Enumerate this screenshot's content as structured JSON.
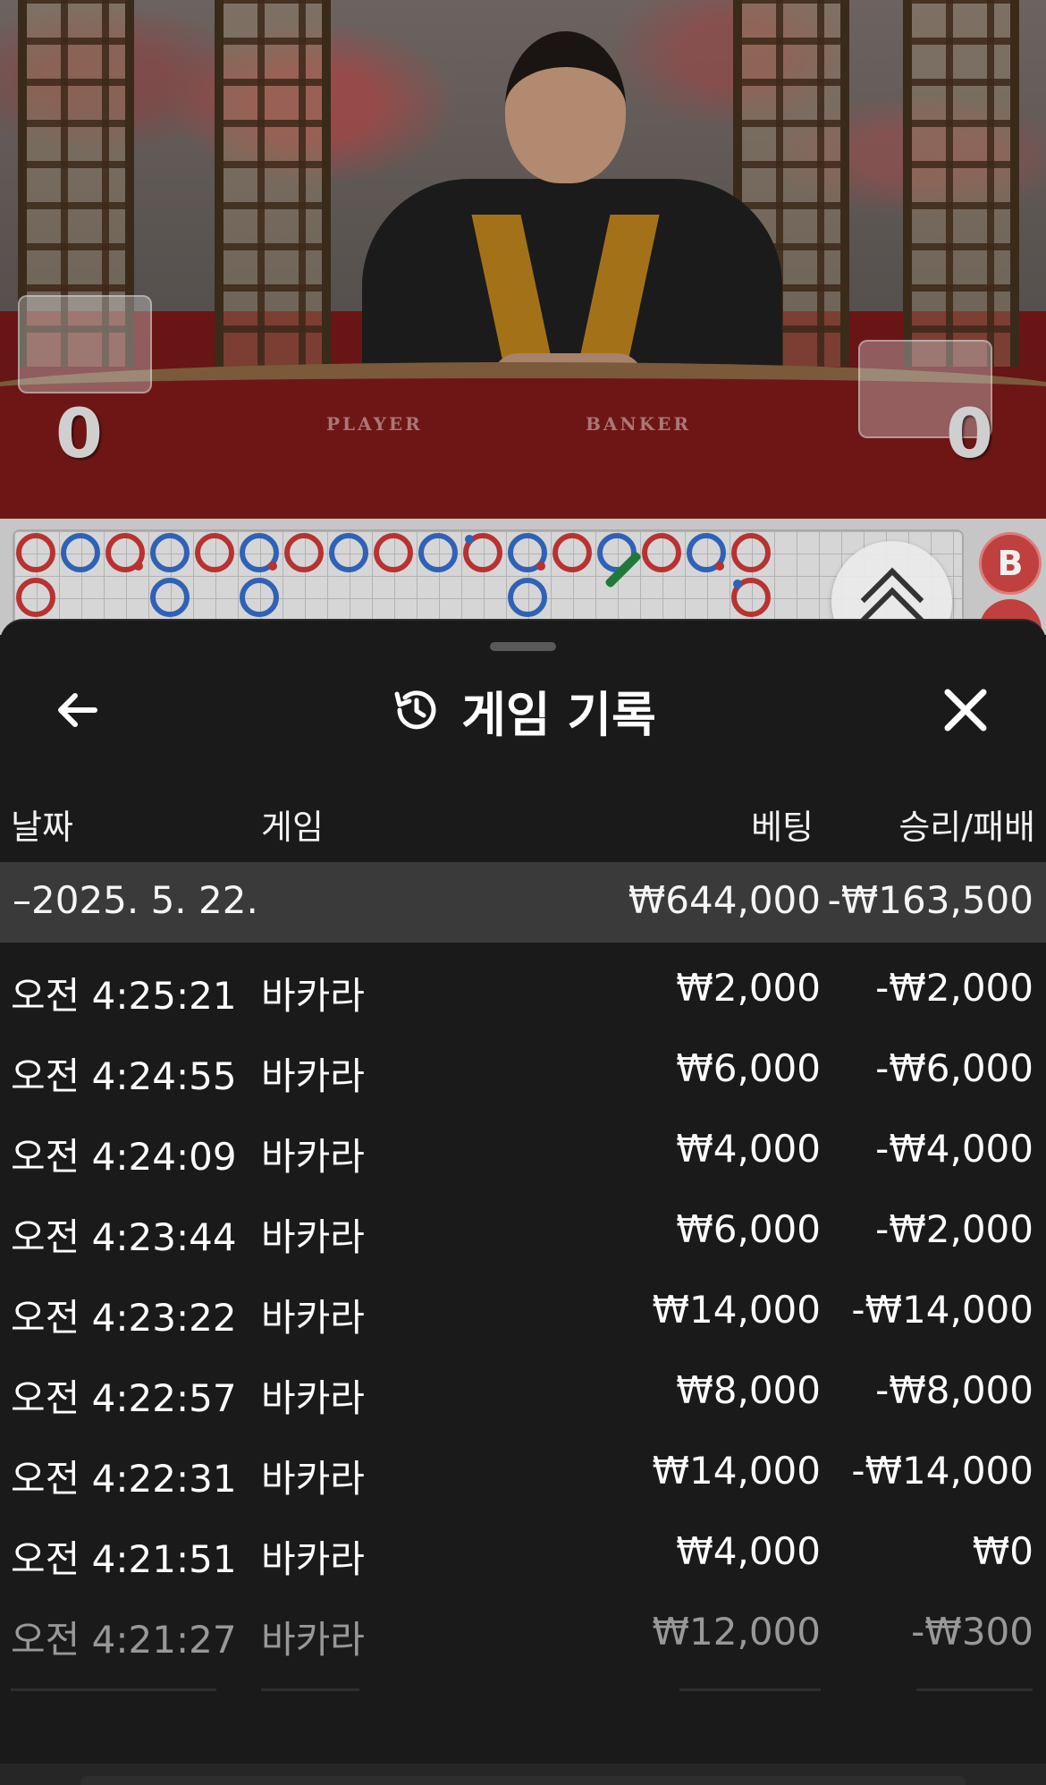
{
  "video": {
    "player_score": "0",
    "banker_score": "0",
    "felt_player_label": "PLAYER",
    "felt_banker_label": "BANKER"
  },
  "roadmap": {
    "bet_chip_label": "B",
    "colors": {
      "player": "#2f62b5",
      "banker": "#b83232",
      "tie": "#1f7a3a"
    }
  },
  "sheet": {
    "title": "게임 기록",
    "icons": {
      "back": "arrow-left-icon",
      "history": "history-icon",
      "close": "close-icon"
    }
  },
  "table": {
    "headers": {
      "date": "날짜",
      "game": "게임",
      "bet": "베팅",
      "win_loss": "승리/패배"
    },
    "date_group": {
      "date": "–2025. 5. 22.",
      "bet_total": "₩644,000",
      "win_loss_total": "-₩163,500"
    },
    "rows": [
      {
        "time": "오전 4:25:21",
        "game": "바카라",
        "bet": "₩2,000",
        "win_loss": "-₩2,000"
      },
      {
        "time": "오전 4:24:55",
        "game": "바카라",
        "bet": "₩6,000",
        "win_loss": "-₩6,000"
      },
      {
        "time": "오전 4:24:09",
        "game": "바카라",
        "bet": "₩4,000",
        "win_loss": "-₩4,000"
      },
      {
        "time": "오전 4:23:44",
        "game": "바카라",
        "bet": "₩6,000",
        "win_loss": "-₩2,000"
      },
      {
        "time": "오전 4:23:22",
        "game": "바카라",
        "bet": "₩14,000",
        "win_loss": "-₩14,000"
      },
      {
        "time": "오전 4:22:57",
        "game": "바카라",
        "bet": "₩8,000",
        "win_loss": "-₩8,000"
      },
      {
        "time": "오전 4:22:31",
        "game": "바카라",
        "bet": "₩14,000",
        "win_loss": "-₩14,000"
      },
      {
        "time": "오전 4:21:51",
        "game": "바카라",
        "bet": "₩4,000",
        "win_loss": "₩0"
      },
      {
        "time": "오전 4:21:27",
        "game": "바카라",
        "bet": "₩12,000",
        "win_loss": "-₩300"
      }
    ]
  }
}
